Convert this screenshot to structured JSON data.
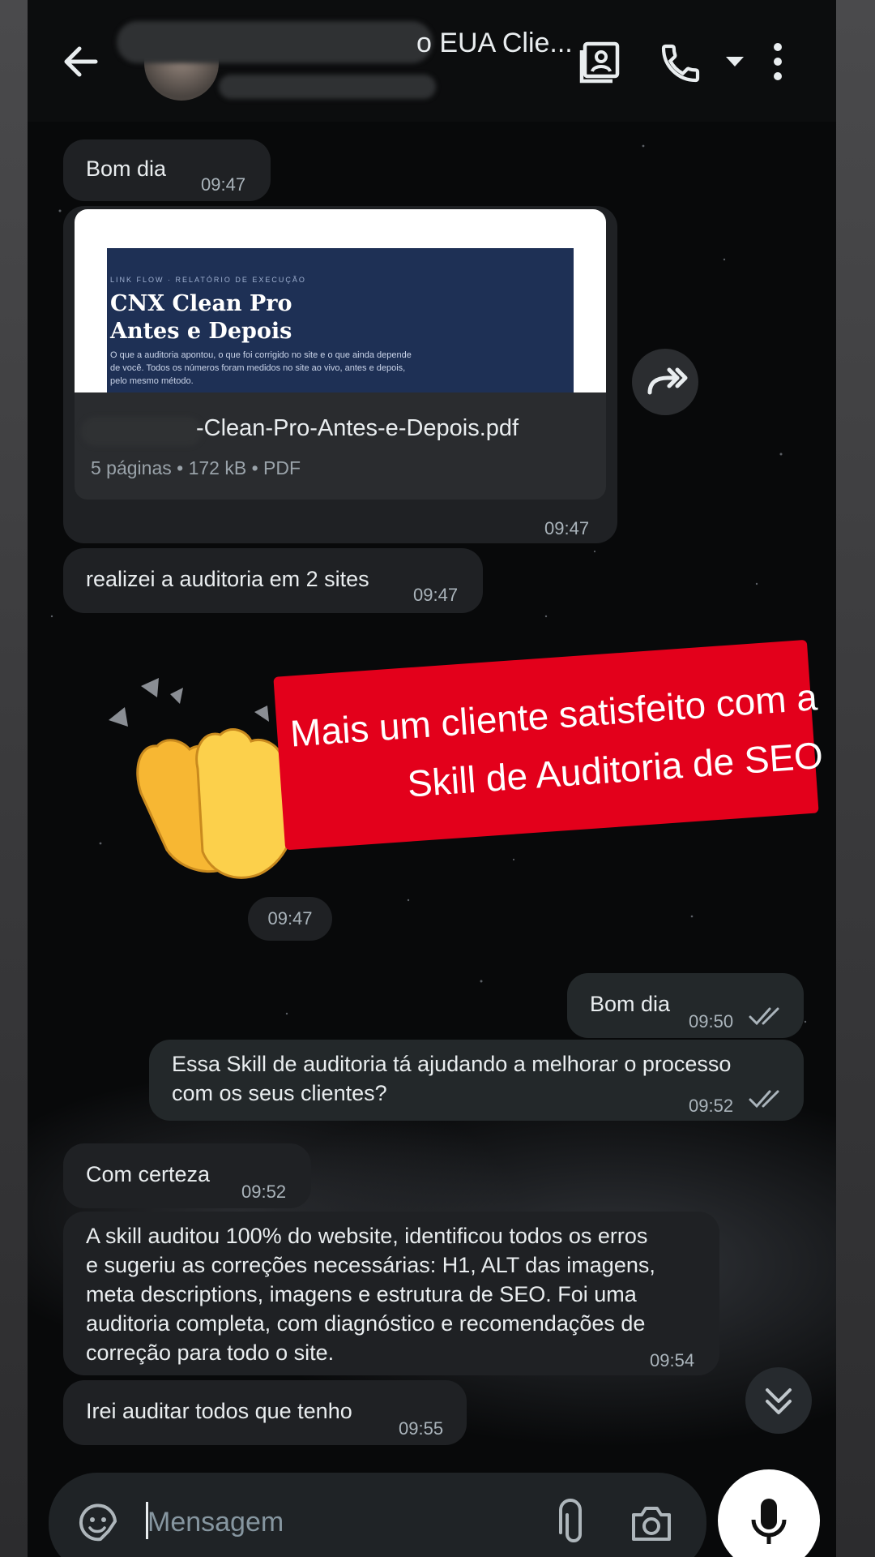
{
  "header": {
    "title": "o EUA Clie...",
    "back_icon": "back-arrow-icon",
    "icons": [
      "contact-card-icon",
      "phone-icon",
      "dropdown-caret-icon",
      "more-vert-icon"
    ]
  },
  "messages": [
    {
      "id": "m1",
      "direction": "in",
      "text": "Bom dia",
      "time": "09:47"
    },
    {
      "id": "m2",
      "direction": "in",
      "type": "document",
      "preview": {
        "kicker": "LINK FLOW · RELATÓRIO DE EXECUÇÃO",
        "heading_1": "CNX Clean Pro",
        "heading_2": "Antes e Depois",
        "description": "O que a auditoria apontou, o que foi corrigido no site e o que ainda depende de você. Todos os números foram medidos no site ao vivo, antes e depois, pelo mesmo método."
      },
      "file_name": "-Clean-Pro-Antes-e-Depois.pdf",
      "meta": "5 páginas • 172 kB • PDF",
      "time": "09:47"
    },
    {
      "id": "m3",
      "direction": "in",
      "text": "realizei a auditoria em 2 sites",
      "time": "09:47"
    },
    {
      "id": "m4",
      "direction": "in",
      "type": "sticker",
      "time": "09:47"
    },
    {
      "id": "m5",
      "direction": "out",
      "text": "Bom dia",
      "time": "09:50",
      "status": "read"
    },
    {
      "id": "m6",
      "direction": "out",
      "text_line1": "Essa Skill de auditoria tá ajudando a melhorar o processo",
      "text_line2": "com os seus clientes?",
      "time": "09:52",
      "status": "read"
    },
    {
      "id": "m7",
      "direction": "in",
      "text": "Com certeza",
      "time": "09:52"
    },
    {
      "id": "m8",
      "direction": "in",
      "lines": [
        "A skill auditou 100% do website, identificou todos os erros",
        "e sugeriu as correções necessárias: H1, ALT das imagens,",
        "meta descriptions, imagens e estrutura de SEO. Foi uma",
        "auditoria completa, com diagnóstico e recomendações de",
        "correção para todo o site."
      ],
      "time": "09:54"
    },
    {
      "id": "m9",
      "direction": "in",
      "text": "Irei auditar todos que tenho",
      "time": "09:55"
    }
  ],
  "overlay": {
    "line1": "Mais um cliente satisfeito com a",
    "line2": "Skill de Auditoria de SEO",
    "color": "#e3001b"
  },
  "composer": {
    "placeholder": "Mensagem",
    "icons": [
      "sticker-icon",
      "attach-icon",
      "camera-icon",
      "mic-icon"
    ]
  },
  "colors": {
    "incoming_bubble": "#1f2124",
    "outgoing_bubble": "#23282a",
    "read_ticks": "#aab4bb"
  }
}
